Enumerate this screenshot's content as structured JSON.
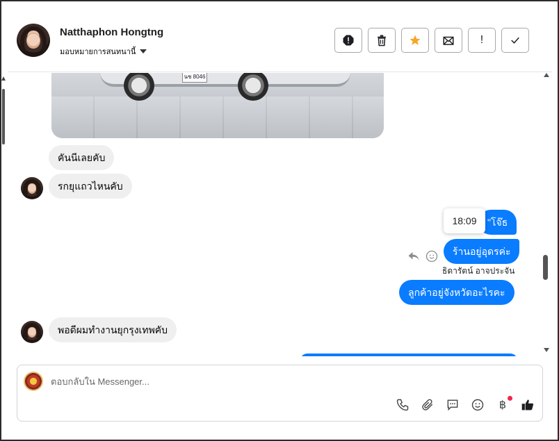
{
  "header": {
    "contact_name": "Natthaphon Hongtng",
    "assign_label": "มอบหมายการสนทนานี้",
    "toolbar": {
      "report": "report-icon",
      "delete": "trash-icon",
      "star": "star-icon",
      "mark_unread": "envelope-icon",
      "important_label": "!",
      "done": "check-icon"
    },
    "accent_star": "#f5a623"
  },
  "messages": [
    {
      "direction": "in",
      "text": "คันนีเลยคับ"
    },
    {
      "direction": "in",
      "text": "รกยุแถวไหนคับ"
    },
    {
      "direction": "out",
      "text": "\"โจ๊ธ"
    },
    {
      "direction": "out",
      "text": "ร้านอยู่อุดรค่ะ"
    },
    {
      "direction": "out",
      "text": "ลูกค้าอยู่จังหวัดอะไรคะ"
    },
    {
      "direction": "in",
      "text": "พอดีผมทำงานยุกรุงเทพคับ"
    }
  ],
  "tooltip_time": "18:09",
  "sender_label": "ธิดารัตน์ อาจประจัน",
  "photo_plate": "นช 8046",
  "composer": {
    "placeholder": "ตอบกลับใน Messenger..."
  },
  "colors": {
    "outgoing_bubble": "#0a7cff",
    "incoming_bubble": "#efefef"
  }
}
